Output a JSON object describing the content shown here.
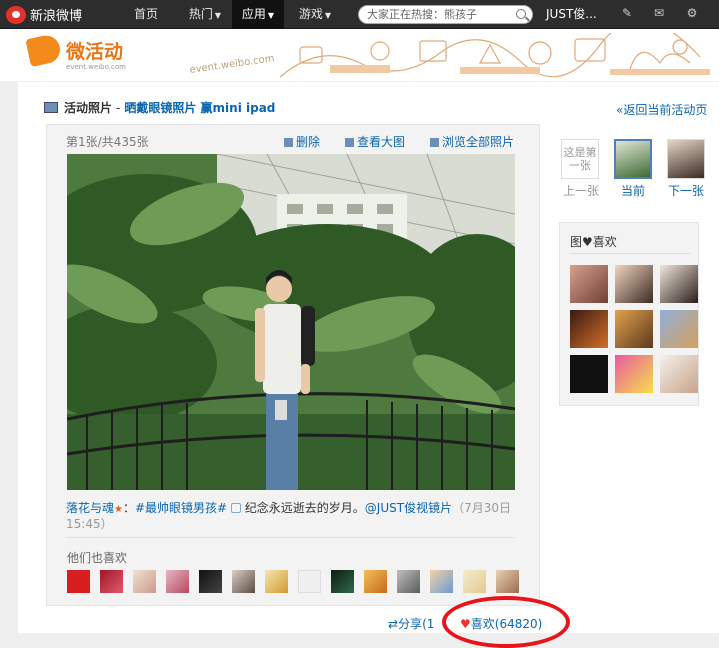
{
  "topbar": {
    "logo_text": "新浪微博",
    "nav": [
      {
        "label": "首页"
      },
      {
        "label": "热门"
      },
      {
        "label": "应用"
      },
      {
        "label": "游戏"
      }
    ],
    "search_placeholder": "大家正在热搜：熊孩子",
    "user": "JUST俊..."
  },
  "banner": {
    "title": "微活动",
    "subtitle": "event.weibo.com",
    "deco_text": "event.weibo.com"
  },
  "breadcrumb": {
    "section": "活动照片",
    "separator": "-",
    "event_title": "晒戴眼镜照片 赢mini ipad",
    "back_link": "«返回当前活动页"
  },
  "photo_viewer": {
    "count": "第1张/共435张",
    "actions": {
      "delete": "删除",
      "view_large": "查看大图",
      "browse_all": "浏览全部照片"
    },
    "caption": {
      "author": "落花与魂",
      "colon": "：",
      "hashtag": "#最帅眼镜男孩#",
      "text": "纪念永远逝去的岁月。",
      "mention": "@JUST俊视镜片",
      "date": "（7月30日 15:45）"
    },
    "also_like_label": "他们也喜欢",
    "share": "分享(1",
    "like": "喜欢(64820)"
  },
  "side_nav": {
    "prev_placeholder": "这是第一张",
    "prev_label": "上一张",
    "current_label": "当前",
    "next_label": "下一张"
  },
  "like_panel": {
    "title": "图♥喜欢"
  },
  "colors": {
    "accent": "#0a66b0",
    "brand_orange": "#e8771a",
    "highlight_ring": "#e8141a",
    "topbar": "#2d2d2d"
  }
}
